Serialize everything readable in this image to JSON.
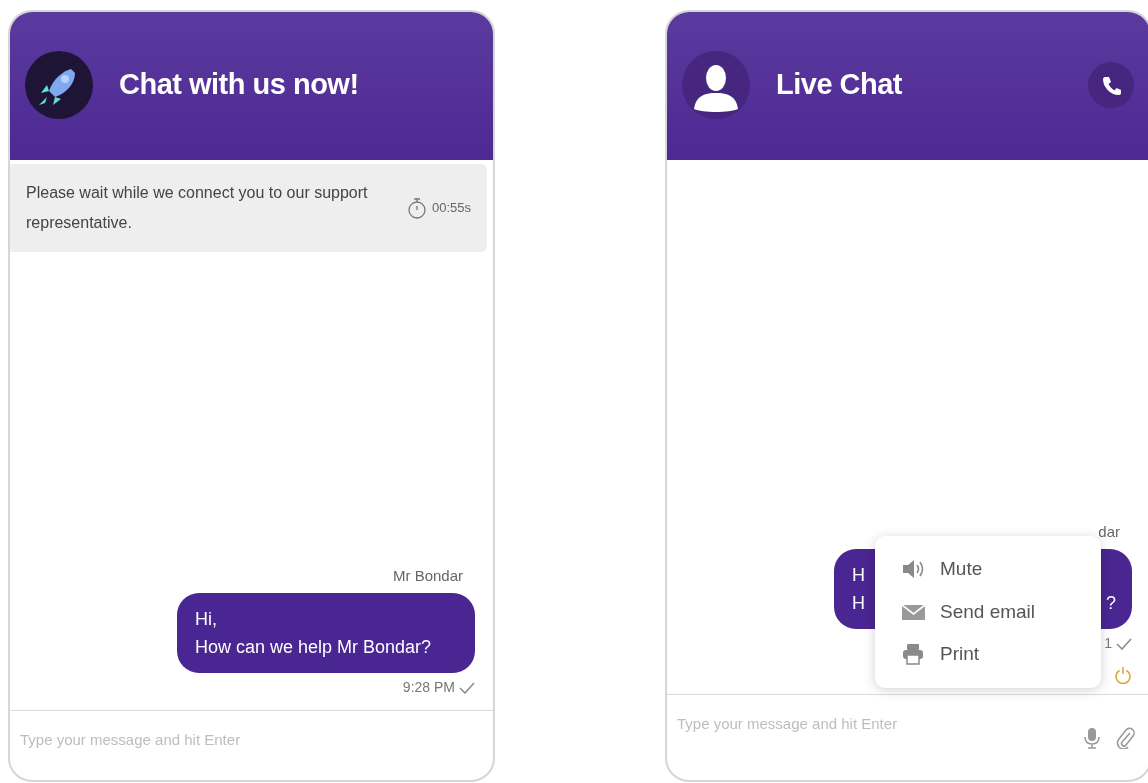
{
  "panels": [
    {
      "kind": "connecting",
      "header": {
        "title": "Chat with us now!"
      },
      "notice": {
        "text": "Please wait while we connect you to our support representative.",
        "timer": "00:55s"
      },
      "messages": [
        {
          "sender": "Mr Bondar",
          "lines": [
            "Hi,",
            "How can we help Mr Bondar?"
          ],
          "time": "9:28 PM",
          "delivered": true
        }
      ],
      "input": {
        "placeholder": "Type your message and hit Enter"
      }
    },
    {
      "kind": "live",
      "header": {
        "title": "Live Chat"
      },
      "messages": [
        {
          "sender": "dar",
          "lines": [
            "H",
            "H"
          ],
          "trailing": "?",
          "time": "1",
          "delivered": true
        }
      ],
      "menu": {
        "items": [
          {
            "label": "Mute"
          },
          {
            "label": "Send email"
          },
          {
            "label": "Print"
          }
        ]
      },
      "input": {
        "placeholder": "Type your message and hit Enter"
      }
    }
  ]
}
